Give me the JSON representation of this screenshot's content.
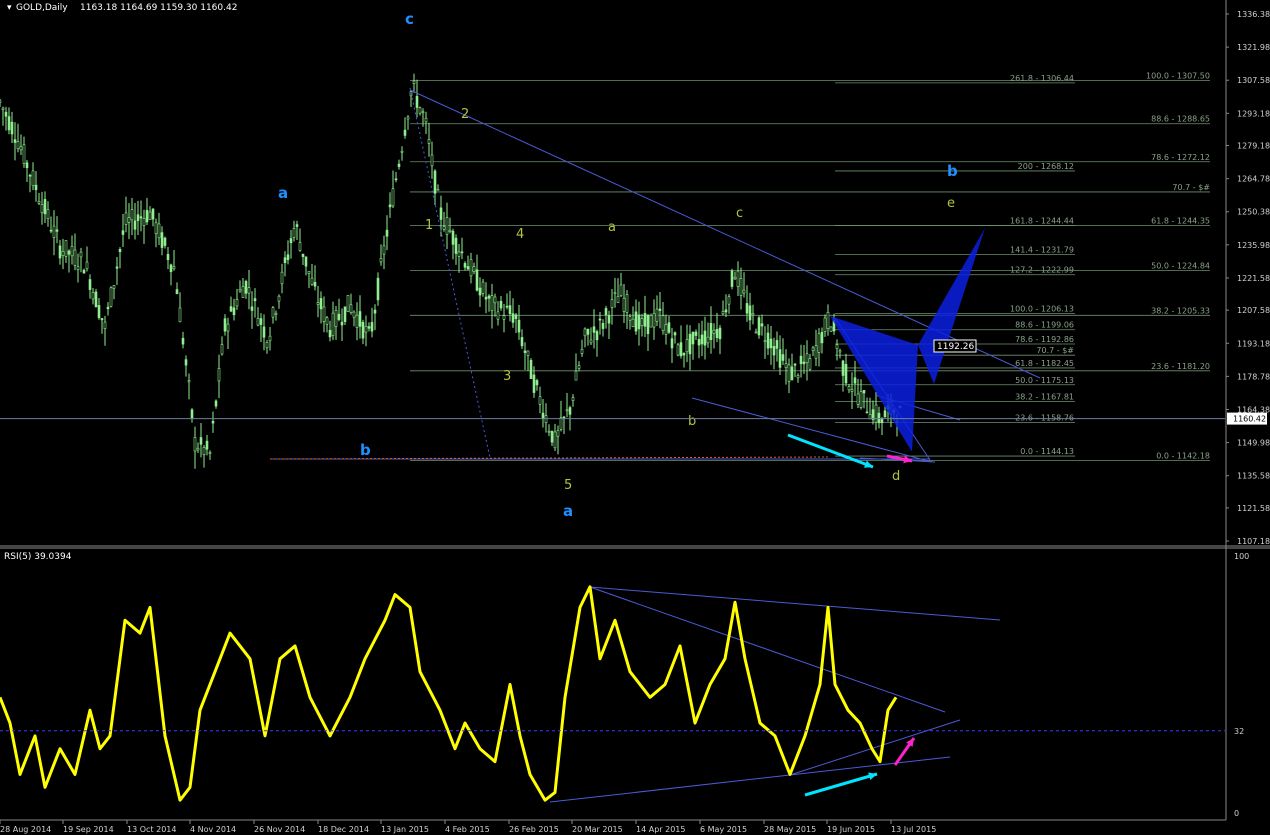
{
  "header": {
    "symbol": "GOLD,Daily",
    "ohlc": "1163.18 1164.69 1159.30 1160.42"
  },
  "chart_data": [
    {
      "type": "candlestick",
      "symbol": "GOLD",
      "timeframe": "Daily",
      "open": 1163.18,
      "high": 1164.69,
      "low": 1159.3,
      "close": 1160.42,
      "ylim": [
        1100.0,
        1340.0
      ],
      "price_ticks": [
        1107.18,
        1121.58,
        1135.58,
        1149.98,
        1164.38,
        1178.78,
        1193.18,
        1207.58,
        1221.58,
        1235.98,
        1250.38,
        1264.78,
        1279.18,
        1293.18,
        1307.58,
        1321.98,
        1336.38
      ],
      "current_price_label": "1160.42",
      "current_price": 1160.42,
      "box_label": "1192.26",
      "box_price": 1192.26,
      "x_labels": [
        "28 Aug 2014",
        "19 Sep 2014",
        "13 Oct 2014",
        "4 Nov 2014",
        "26 Nov 2014",
        "18 Dec 2014",
        "13 Jan 2015",
        "4 Feb 2015",
        "26 Feb 2015",
        "20 Mar 2015",
        "14 Apr 2015",
        "6 May 2015",
        "28 May 2015",
        "19 Jun 2015",
        "13 Jul 2015"
      ],
      "fib_left": [
        {
          "label": "261.8 - 1306.44",
          "value": 1306.44
        },
        {
          "label": "200 - 1268.12",
          "value": 1268.12
        },
        {
          "label": "161.8 - 1244.44",
          "value": 1244.44
        },
        {
          "label": "141.4 - 1231.79",
          "value": 1231.79
        },
        {
          "label": "127.2 - 1222.99",
          "value": 1222.99
        },
        {
          "label": "100.0 - 1206.13",
          "value": 1206.13
        },
        {
          "label": "88.6 - 1199.06",
          "value": 1199.06
        },
        {
          "label": "78.6 - 1192.86",
          "value": 1192.86
        },
        {
          "label": "70.7 - $#",
          "value": 1188.0
        },
        {
          "label": "61.8 - 1182.45",
          "value": 1182.45
        },
        {
          "label": "50.0 - 1175.13",
          "value": 1175.13
        },
        {
          "label": "38.2 - 1167.81",
          "value": 1167.81
        },
        {
          "label": "23.6 - 1158.76",
          "value": 1158.76
        },
        {
          "label": "0.0 - 1144.13",
          "value": 1144.13
        }
      ],
      "fib_right": [
        {
          "label": "100.0 - 1307.50",
          "value": 1307.5
        },
        {
          "label": "88.6 - 1288.65",
          "value": 1288.65
        },
        {
          "label": "78.6 - 1272.12",
          "value": 1272.12
        },
        {
          "label": "70.7 - $#",
          "value": 1259.0
        },
        {
          "label": "61.8 - 1244.35",
          "value": 1244.35
        },
        {
          "label": "50.0 - 1224.84",
          "value": 1224.84
        },
        {
          "label": "38.2 - 1205.33",
          "value": 1205.33
        },
        {
          "label": "23.6 - 1181.20",
          "value": 1181.2
        },
        {
          "label": "0.0 - 1142.18",
          "value": 1142.18
        }
      ],
      "wave_labels_blue": [
        "c",
        "a",
        "b",
        "a",
        "b"
      ],
      "wave_labels_count": [
        "1",
        "2",
        "3",
        "4",
        "5"
      ],
      "wave_labels_minor": [
        "a",
        "b",
        "c",
        "d",
        "e"
      ]
    },
    {
      "type": "line",
      "indicator": "RSI(5) 39.0394",
      "title": "RSI(5) 39.0394",
      "ylim": [
        0,
        100
      ],
      "y_ticks": [
        "100",
        "32",
        "0"
      ],
      "level": 32
    }
  ],
  "colors": {
    "background": "#000000",
    "candle": "#90ee90",
    "fib_line": "#6f8f6f",
    "trendline": "#4a5bd6",
    "pattern_fill": "#0a20e0",
    "rsi_line": "#ffff00",
    "wave_blue": "#1e90ff",
    "wave_count": "#b5c23a",
    "cyan_arrow": "#00e5ff",
    "magenta_arrow": "#ff22cc",
    "axis_text": "#d0d0d0"
  }
}
